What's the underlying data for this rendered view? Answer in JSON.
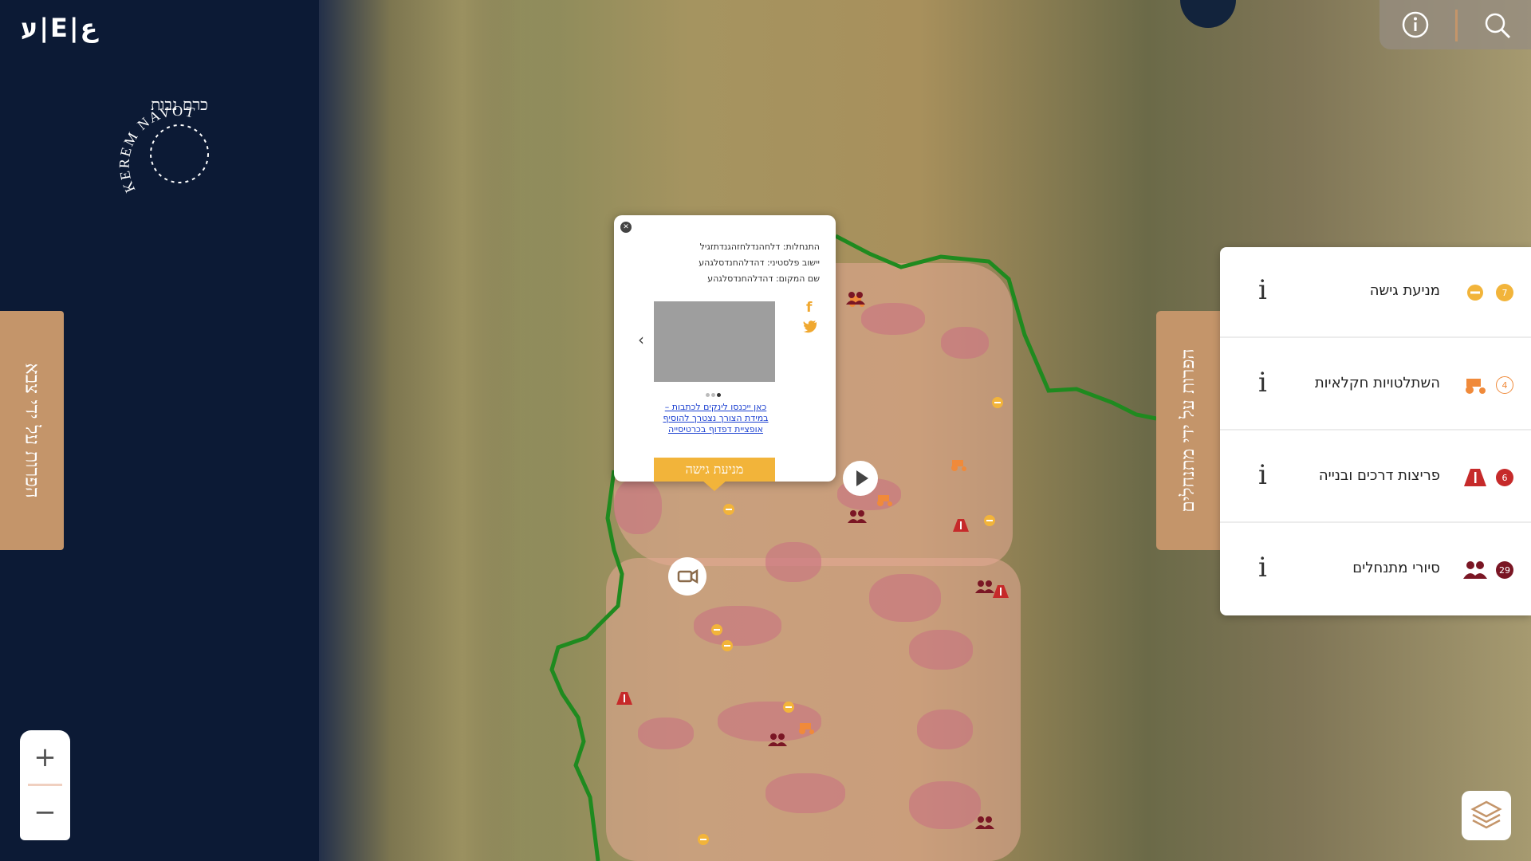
{
  "brand": {
    "logo_text": "ע|E|ع",
    "org_name": "KEREM NAVOT",
    "org_name_he": "כרם נבות"
  },
  "left_tab": {
    "label": "הפרות על ידי צבא"
  },
  "right_tab": {
    "label": "הפרות על ידי מתנחלים"
  },
  "top_bar": {
    "info_icon": "info-icon",
    "search_icon": "search-icon"
  },
  "legend": {
    "items": [
      {
        "label": "מניעת גישה",
        "count": "7",
        "color": "#f2b43a",
        "icon": "no-entry-icon"
      },
      {
        "label": "השתלטויות חקלאיות",
        "count": "4",
        "color": "#f08a3a",
        "icon": "tractor-icon"
      },
      {
        "label": "פריצות דרכים ובנייה",
        "count": "6",
        "color": "#c62a2a",
        "icon": "road-icon"
      },
      {
        "label": "סיורי מתנחלים",
        "count": "29",
        "color": "#7a1624",
        "icon": "people-icon"
      }
    ],
    "info_label": "i"
  },
  "popup": {
    "lines": [
      "התנחלות: דלחהנדלחזהגנדתזגיל",
      "יישוב פלסטיני: דהדלהחנדסלגהע",
      "שם המקום: דהדלהחנדסלגהע"
    ],
    "link_text": "כאן ייכנסו לינקים לכתבות – במידת הצורך נצטרך להוסיף אופציית דפדוף בכרטיסייה",
    "action_label": "מניעת גישה",
    "close_icon": "close-icon",
    "prev_icon": "chevron-left-icon",
    "social": [
      "facebook-icon",
      "twitter-icon"
    ]
  },
  "zoom": {
    "in_label": "+",
    "out_label": "−"
  },
  "colors": {
    "tab": "#c4956a",
    "border_line": "#1f8a1f",
    "access": "#f2b43a",
    "agri": "#f08a3a",
    "road": "#c62a2a",
    "patrol": "#7a1624"
  }
}
